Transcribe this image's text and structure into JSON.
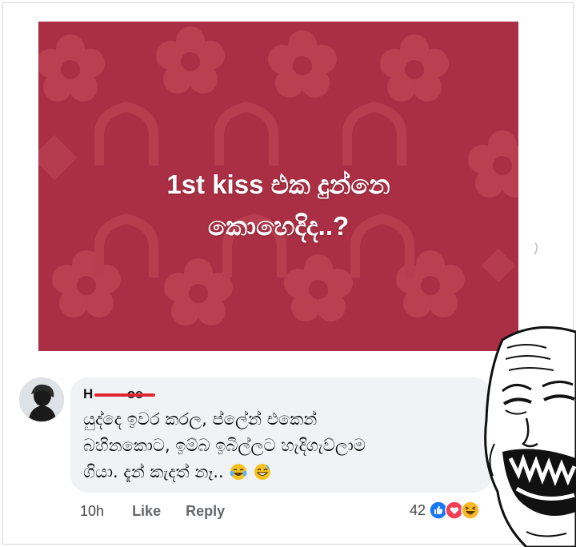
{
  "post": {
    "caption_line1": "1st kiss එක දුන්නෙ",
    "caption_line2": "කොහෙදිද..?",
    "background_color": "#a8293e"
  },
  "comment": {
    "author": "H████ Zoe",
    "author_visible": "H         oe",
    "text_line1": "යුද්දෙ ඉවර කරල, ප්ලේන් එකෙන්",
    "text_line2": "බහිනකොට, ඉම්බ ඉබිල්ලට හැදිගැව්ලාම",
    "text_line3": "ගියා. දැන් කැදත් නෑ..",
    "time": "10h",
    "like_label": "Like",
    "reply_label": "Reply",
    "reaction_count": "42",
    "reactions": [
      "like-icon",
      "love-icon",
      "haha-icon"
    ]
  },
  "colors": {
    "bubble": "#f0f2f5",
    "redaction": "#e0242c",
    "like_blue": "#1877f2",
    "love_red": "#f33e58",
    "haha_yellow": "#f7b928"
  }
}
